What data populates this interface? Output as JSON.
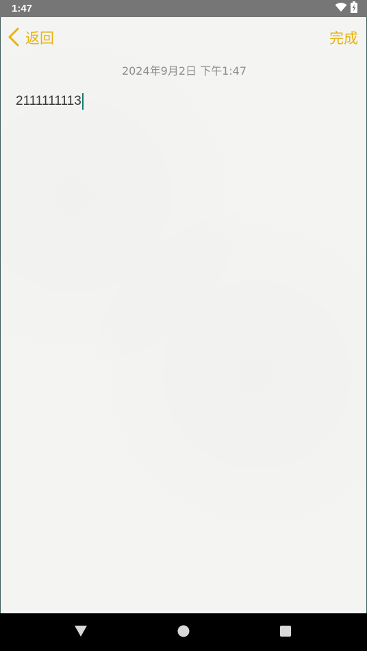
{
  "status_bar": {
    "time": "1:47",
    "icons": [
      "wifi-icon",
      "battery-charging-icon"
    ]
  },
  "header": {
    "back_label": "返回",
    "done_label": "完成"
  },
  "note": {
    "date": "2024年9月2日 下午1:47",
    "body": "2111111113"
  },
  "nav_bar": {
    "buttons": [
      "back-triangle-icon",
      "home-circle-icon",
      "recents-square-icon"
    ]
  },
  "colors": {
    "accent": "#e8b30f",
    "status_bar_bg": "#767676",
    "paper_bg": "#f4f4f2",
    "cursor": "#117a72",
    "nav_bar_bg": "#000000"
  }
}
